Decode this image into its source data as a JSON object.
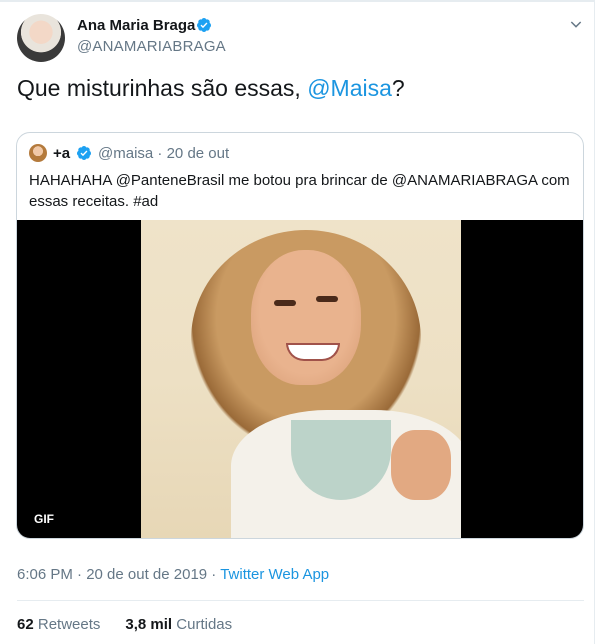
{
  "author": {
    "name": "Ana Maria Braga",
    "handle": "@ANAMARIABRAGA"
  },
  "tweet": {
    "text_before": "Que misturinhas são essas, ",
    "mention": "@Maisa",
    "text_after": "?"
  },
  "quoted": {
    "name": "+a",
    "handle": "@maisa",
    "separator": "·",
    "date": "20 de out",
    "text": "HAHAHAHA @PanteneBrasil me botou pra brincar de @ANAMARIABRAGA com essas receitas. #ad",
    "media_badge": "GIF"
  },
  "meta": {
    "time_date": "6:06 PM · 20 de out de 2019 · ",
    "source": "Twitter Web App"
  },
  "stats": {
    "retweets_count": "62",
    "retweets_label": "Retweets",
    "likes_count": "3,8 mil",
    "likes_label": "Curtidas"
  },
  "colors": {
    "accent": "#1b95e0",
    "secondary_text": "#657786",
    "verified": "#1da1f2"
  },
  "icons": [
    "verified-badge-icon",
    "chevron-down-icon"
  ]
}
